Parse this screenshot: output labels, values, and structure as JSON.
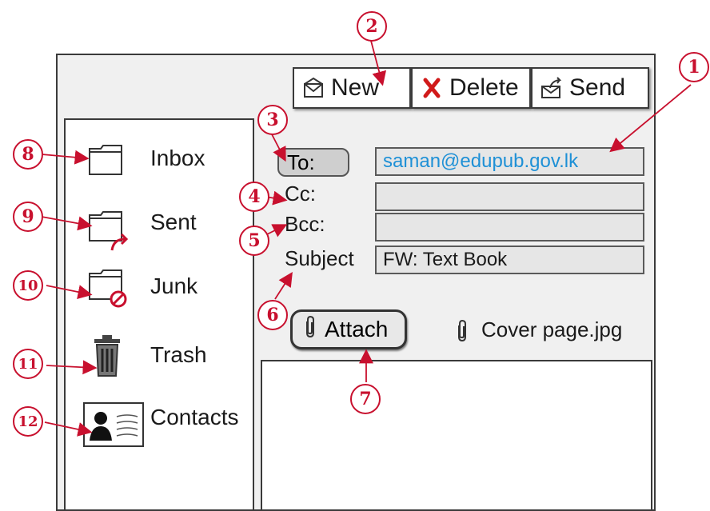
{
  "toolbar": {
    "new_label": "New",
    "delete_label": "Delete",
    "send_label": "Send"
  },
  "sidebar": {
    "items": [
      {
        "label": "Inbox",
        "icon": "folder-icon"
      },
      {
        "label": "Sent",
        "icon": "folder-sent-icon"
      },
      {
        "label": "Junk",
        "icon": "folder-junk-icon"
      },
      {
        "label": "Trash",
        "icon": "trash-icon"
      },
      {
        "label": "Contacts",
        "icon": "contact-card-icon"
      }
    ]
  },
  "compose": {
    "to_label": "To:",
    "to_value": "saman@edupub.gov.lk",
    "cc_label": "Cc:",
    "cc_value": "",
    "bcc_label": "Bcc:",
    "bcc_value": "",
    "subject_label": "Subject",
    "subject_value": "FW: Text Book",
    "attach_label": "Attach",
    "attachment_name": "Cover page.jpg"
  },
  "callouts": [
    "1",
    "2",
    "3",
    "4",
    "5",
    "6",
    "7",
    "8",
    "9",
    "10",
    "11",
    "12"
  ],
  "colors": {
    "callout": "#c8102e",
    "email_link": "#1e90d6",
    "delete_x": "#d11a1a"
  }
}
